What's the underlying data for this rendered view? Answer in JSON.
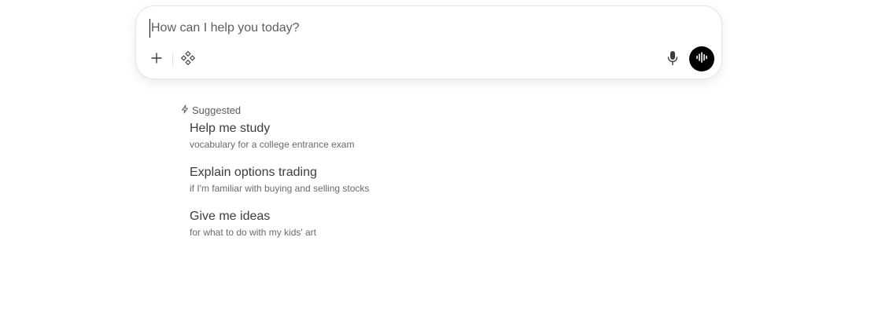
{
  "composer": {
    "placeholder": "How can I help you today?",
    "icons": {
      "add": "plus-icon",
      "tools": "tools-diamond-icon",
      "mic": "microphone-icon",
      "voice": "voice-waveform-icon"
    },
    "voice_button_color": "#000000"
  },
  "suggested": {
    "header": "Suggested",
    "header_icon": "lightning-icon",
    "items": [
      {
        "title": "Help me study",
        "subtitle": "vocabulary for a college entrance exam"
      },
      {
        "title": "Explain options trading",
        "subtitle": "if I'm familiar with buying and selling stocks"
      },
      {
        "title": "Give me ideas",
        "subtitle": "for what to do with my kids' art"
      }
    ]
  }
}
